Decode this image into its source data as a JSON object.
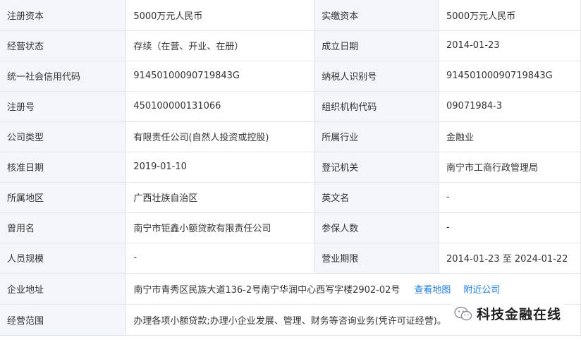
{
  "rows": [
    {
      "l1": "注册资本",
      "v1": "5000万元人民币",
      "l2": "实缴资本",
      "v2": "5000万元人民币"
    },
    {
      "l1": "经营状态",
      "v1": "存续（在营、开业、在册）",
      "l2": "成立日期",
      "v2": "2014-01-23"
    },
    {
      "l1": "统一社会信用代码",
      "v1": "91450100090719843G",
      "l2": "纳税人识别号",
      "v2": "91450100090719843G"
    },
    {
      "l1": "注册号",
      "v1": "450100000131066",
      "l2": "组织机构代码",
      "v2": "09071984-3"
    },
    {
      "l1": "公司类型",
      "v1": "有限责任公司(自然人投资或控股)",
      "l2": "所属行业",
      "v2": "金融业"
    },
    {
      "l1": "核准日期",
      "v1": "2019-01-10",
      "l2": "登记机关",
      "v2": "南宁市工商行政管理局"
    },
    {
      "l1": "所属地区",
      "v1": "广西壮族自治区",
      "l2": "英文名",
      "v2": "-"
    },
    {
      "l1": "曾用名",
      "v1": "南宁市钜鑫小额贷款有限责任公司",
      "l2": "参保人数",
      "v2": "-"
    },
    {
      "l1": "人员规模",
      "v1": "-",
      "l2": "营业期限",
      "v2": "2014-01-23 至 2024-01-22"
    }
  ],
  "address": {
    "label": "企业地址",
    "value": "南宁市青秀区民族大道136-2号南宁华润中心西写字楼2902-02号",
    "map_link": "查看地图",
    "nearby_link": "附近公司"
  },
  "scope": {
    "label": "经营范围",
    "value": "办理各项小额贷款;办理小企业发展、管理、财务等咨询业务(凭许可证经营)。"
  },
  "watermark": {
    "text": "科技金融在线",
    "icon": "wechat-icon"
  },
  "colors": {
    "label_bg": "#f2f5fa",
    "border": "#e4e7ec",
    "link": "#1f7ee0",
    "text": "#333333"
  }
}
